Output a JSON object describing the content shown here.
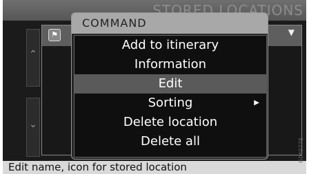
{
  "screen": {
    "title": "STORED LOCATIONS"
  },
  "menu": {
    "title": "COMMAND",
    "items": [
      {
        "label": "Add to itinerary"
      },
      {
        "label": "Information"
      },
      {
        "label": "Edit",
        "selected": true
      },
      {
        "label": "Sorting",
        "has_submenu": true
      },
      {
        "label": "Delete location"
      },
      {
        "label": "Delete all"
      }
    ]
  },
  "status_bar": {
    "text": "Edit name, icon for stored location"
  },
  "reference_code": "G040778",
  "icons": {
    "pin": "pin-icon",
    "dropdown": "triangle-down-icon",
    "scroll_up": "chevron-up-icon",
    "scroll_down": "chevron-down-icon",
    "submenu": "triangle-right-icon"
  },
  "colors": {
    "menu_title_bg": "#a8a8a8",
    "selected_item_bg": "#5a5a5a",
    "menu_bg": "#0f0f0f",
    "status_bar_bg": "#d9d9d9"
  }
}
